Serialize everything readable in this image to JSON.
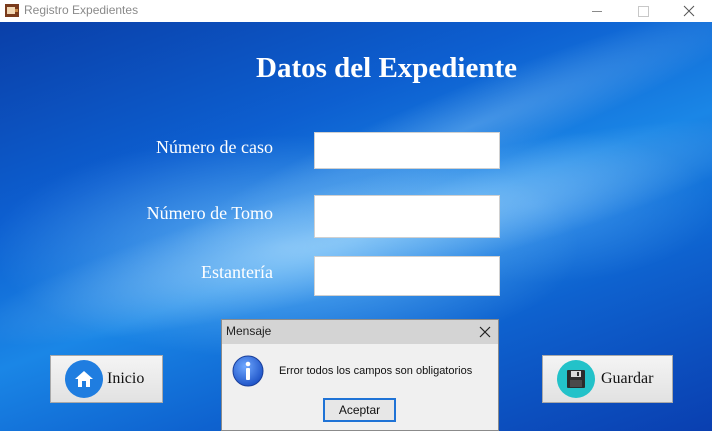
{
  "window": {
    "title": "Registro Expedientes",
    "icon": "coffee-cup-app-icon"
  },
  "form": {
    "title": "Datos del Expediente",
    "fields": [
      {
        "label": "Número de caso",
        "value": ""
      },
      {
        "label": "Número de Tomo",
        "value": ""
      },
      {
        "label": "Estantería",
        "value": ""
      }
    ],
    "buttons": {
      "home_label": "Inicio",
      "save_label": "Guardar"
    },
    "colors": {
      "background_dark": "#0a3fa8",
      "background_light": "#1a86e6"
    }
  },
  "dialog": {
    "title": "Mensaje",
    "message": "Error todos los campos son obligatorios",
    "ok_label": "Aceptar",
    "icon": "info-icon"
  }
}
